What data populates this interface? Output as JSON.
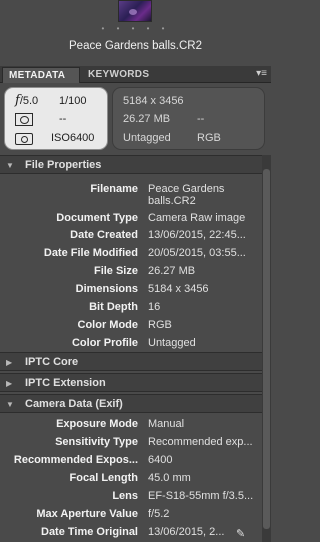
{
  "header": {
    "dots": "• • • • •",
    "filename": "Peace Gardens balls.CR2"
  },
  "tabs": [
    {
      "label": "METADATA",
      "active": true
    },
    {
      "label": "KEYWORDS",
      "active": false
    }
  ],
  "panel_menu_icon": "panel-menu-icon",
  "camera_box": {
    "aperture_symbol": "f",
    "aperture": "/5.0",
    "shutter": "1/100",
    "metering": "--",
    "iso": "ISO6400"
  },
  "image_box": {
    "dimensions": "5184 x 3456",
    "filesize": "26.27 MB",
    "filesize_extra": "--",
    "tag": "Untagged",
    "colormode": "RGB"
  },
  "sections": {
    "file_properties": "File Properties",
    "iptc_core": "IPTC Core",
    "iptc_extension": "IPTC Extension",
    "camera_data": "Camera Data (Exif)"
  },
  "file_properties": [
    {
      "key": "Filename",
      "value": "Peace Gardens balls.CR2"
    },
    {
      "key": "Document Type",
      "value": "Camera Raw image"
    },
    {
      "key": "Date Created",
      "value": "13/06/2015, 22:45..."
    },
    {
      "key": "Date File Modified",
      "value": "20/05/2015, 03:55..."
    },
    {
      "key": "File Size",
      "value": "26.27 MB"
    },
    {
      "key": "Dimensions",
      "value": "5184 x 3456"
    },
    {
      "key": "Bit Depth",
      "value": "16"
    },
    {
      "key": "Color Mode",
      "value": "RGB"
    },
    {
      "key": "Color Profile",
      "value": "Untagged"
    }
  ],
  "camera_data": [
    {
      "key": "Exposure Mode",
      "value": "Manual"
    },
    {
      "key": "Sensitivity Type",
      "value": "Recommended exp..."
    },
    {
      "key": "Recommended Expos...",
      "value": "6400"
    },
    {
      "key": "Focal Length",
      "value": "45.0 mm"
    },
    {
      "key": "Lens",
      "value": "EF-S18-55mm f/3.5..."
    },
    {
      "key": "Max Aperture Value",
      "value": "f/5.2"
    },
    {
      "key": "Date Time Original",
      "value": "13/06/2015, 2..."
    }
  ]
}
